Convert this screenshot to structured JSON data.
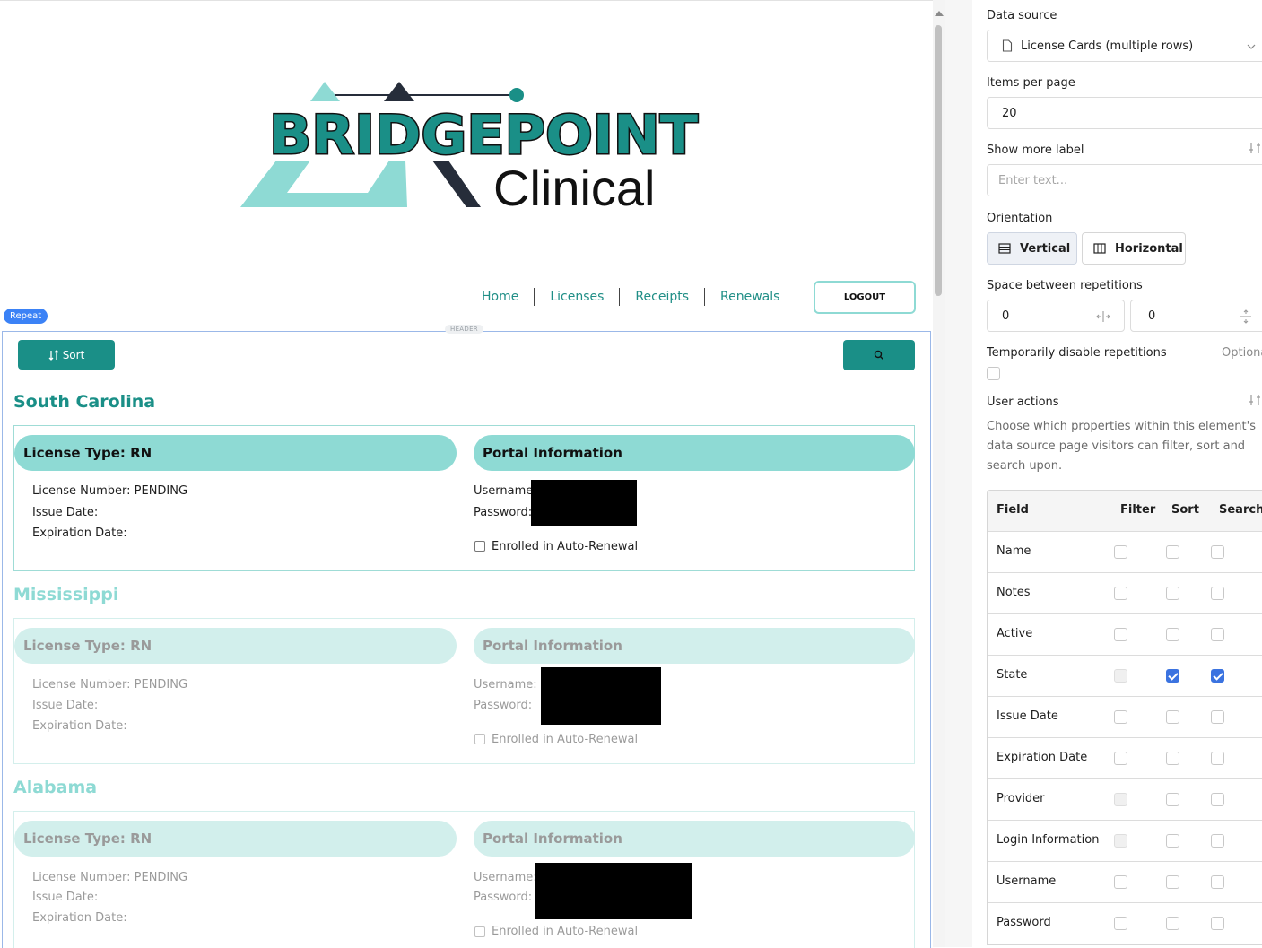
{
  "logo": {
    "line1": "BRIDGEPOINT",
    "line2": "Clinical"
  },
  "nav": {
    "home": "Home",
    "licenses": "Licenses",
    "receipts": "Receipts",
    "renewals": "Renewals",
    "logout": "LOGOUT"
  },
  "repeat_badge": "Repeat",
  "header_tag": "HEADER",
  "toolbar": {
    "sort_label": "Sort",
    "sort_icon": "sort-icon",
    "search_icon": "search-icon"
  },
  "cards": [
    {
      "state": "South Carolina",
      "license_type": "License Type: RN",
      "portal_title": "Portal Information",
      "license_number": "License Number: PENDING",
      "issue_date": "Issue Date:",
      "expiration_date": "Expiration Date:",
      "username": "Username",
      "password": "Password:",
      "auto_renewal": "Enrolled in Auto-Renewal"
    },
    {
      "state": "Mississippi",
      "license_type": "License Type: RN",
      "portal_title": "Portal Information",
      "license_number": "License Number: PENDING",
      "issue_date": "Issue Date:",
      "expiration_date": "Expiration Date:",
      "username": "Username:",
      "password": "Password:",
      "auto_renewal": "Enrolled in Auto-Renewal"
    },
    {
      "state": "Alabama",
      "license_type": "License Type: RN",
      "portal_title": "Portal Information",
      "license_number": "License Number: PENDING",
      "issue_date": "Issue Date:",
      "expiration_date": "Expiration Date:",
      "username": "Username:",
      "password": "Password:",
      "auto_renewal": "Enrolled in Auto-Renewal"
    }
  ],
  "panel": {
    "data_source_label": "Data source",
    "data_source_value": "License Cards (multiple rows)",
    "items_per_page_label": "Items per page",
    "items_per_page_value": "20",
    "show_more_label": "Show more label",
    "show_more_placeholder": "Enter text...",
    "orientation_label": "Orientation",
    "orientation_vertical": "Vertical",
    "orientation_horizontal": "Horizontal",
    "orientation_selected": "Vertical",
    "spacing_label": "Space between repetitions",
    "spacing_h": "0",
    "spacing_v": "0",
    "disable_label": "Temporarily disable repetitions",
    "optional_label": "Optiona",
    "user_actions_label": "User actions",
    "user_actions_desc_1": "Choose which properties within this element's",
    "user_actions_desc_2": "data source page visitors can filter, sort and",
    "user_actions_desc_3": "search upon.",
    "table": {
      "headers": {
        "field": "Field",
        "filter": "Filter",
        "sort": "Sort",
        "search": "Search"
      },
      "rows": [
        {
          "field": "Name",
          "filter": false,
          "filter_disabled": false,
          "sort": false,
          "search": false
        },
        {
          "field": "Notes",
          "filter": false,
          "filter_disabled": false,
          "sort": false,
          "search": false
        },
        {
          "field": "Active",
          "filter": false,
          "filter_disabled": false,
          "sort": false,
          "search": false
        },
        {
          "field": "State",
          "filter": false,
          "filter_disabled": true,
          "sort": true,
          "search": true
        },
        {
          "field": "Issue Date",
          "filter": false,
          "filter_disabled": false,
          "sort": false,
          "search": false
        },
        {
          "field": "Expiration Date",
          "filter": false,
          "filter_disabled": false,
          "sort": false,
          "search": false
        },
        {
          "field": "Provider",
          "filter": false,
          "filter_disabled": true,
          "sort": false,
          "search": false
        },
        {
          "field": "Login Information",
          "filter": false,
          "filter_disabled": true,
          "sort": false,
          "search": false
        },
        {
          "field": "Username",
          "filter": false,
          "filter_disabled": false,
          "sort": false,
          "search": false
        },
        {
          "field": "Password",
          "filter": false,
          "filter_disabled": false,
          "sort": false,
          "search": false
        }
      ]
    }
  },
  "colors": {
    "teal_dark": "#1a8f87",
    "teal_light": "#8edad4",
    "teal_text": "#1f8e86",
    "navy": "#262d3a",
    "checkbox_blue": "#3b73e0"
  }
}
